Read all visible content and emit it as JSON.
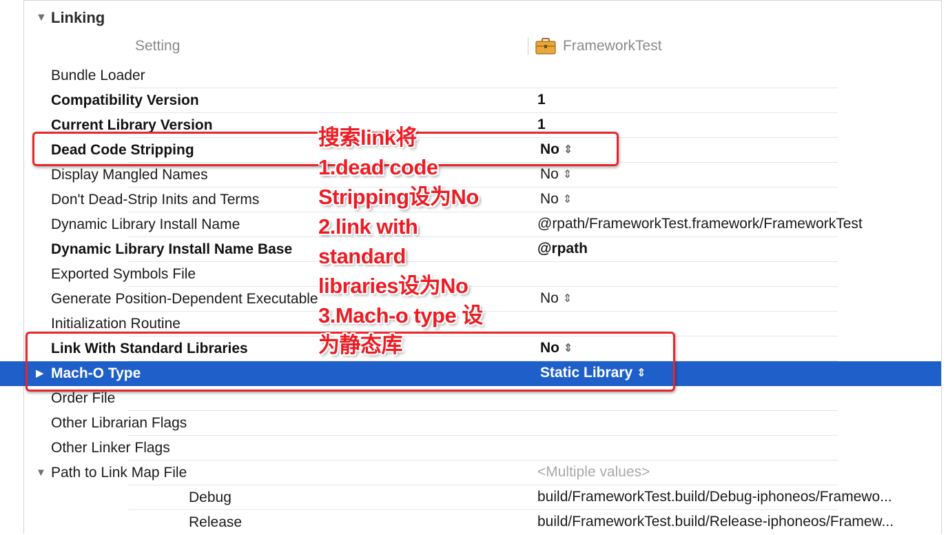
{
  "section": {
    "title": "Linking"
  },
  "columns": {
    "setting": "Setting",
    "target": "FrameworkTest"
  },
  "rows": [
    {
      "name": "Bundle Loader",
      "value": ""
    },
    {
      "name": "Compatibility Version",
      "value": "1"
    },
    {
      "name": "Current Library Version",
      "value": "1"
    },
    {
      "name": "Dead Code Stripping",
      "value": "No"
    },
    {
      "name": "Display Mangled Names",
      "value": "No"
    },
    {
      "name": "Don't Dead-Strip Inits and Terms",
      "value": "No"
    },
    {
      "name": "Dynamic Library Install Name",
      "value": "@rpath/FrameworkTest.framework/FrameworkTest"
    },
    {
      "name": "Dynamic Library Install Name Base",
      "value": "@rpath"
    },
    {
      "name": "Exported Symbols File",
      "value": ""
    },
    {
      "name": "Generate Position-Dependent Executable",
      "value": "No"
    },
    {
      "name": "Initialization Routine",
      "value": ""
    },
    {
      "name": "Link With Standard Libraries",
      "value": "No"
    },
    {
      "name": "Mach-O Type",
      "value": "Static Library"
    },
    {
      "name": "Order File",
      "value": ""
    },
    {
      "name": "Other Librarian Flags",
      "value": ""
    },
    {
      "name": "Other Linker Flags",
      "value": ""
    },
    {
      "name": "Path to Link Map File",
      "value": "<Multiple values>"
    },
    {
      "name": "Debug",
      "value": "build/FrameworkTest.build/Debug-iphoneos/Framewo..."
    },
    {
      "name": "Release",
      "value": "build/FrameworkTest.build/Release-iphoneos/Framew..."
    }
  ],
  "annotation": [
    "搜索link将",
    "1.dead code",
    "Stripping设为No",
    "2.link with",
    "standard",
    "libraries设为No",
    "3.Mach-o type 设",
    "为静态库"
  ],
  "colors": {
    "selection": "#1e5fc9",
    "annotation_red": "#ec1c24"
  },
  "icons": {
    "disclosure_open": "triangle-down-icon",
    "disclosure_closed": "triangle-right-icon",
    "target": "briefcase-icon",
    "popup": "up-down-arrows-icon"
  }
}
